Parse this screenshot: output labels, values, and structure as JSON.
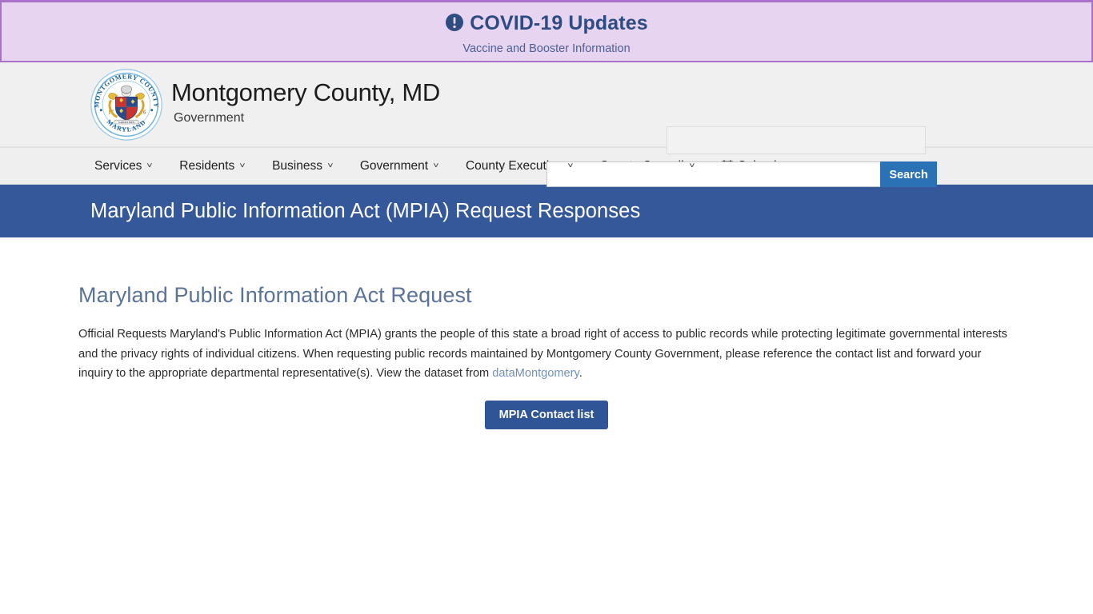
{
  "alert": {
    "icon": "exclamation-circle-icon",
    "title": "COVID-19 Updates",
    "subtitle": "Vaccine and Booster Information",
    "background_color": "#e6d4f1",
    "border_color": "#a972c8",
    "title_color": "#2e4b82"
  },
  "header": {
    "logo": {
      "icon": "montgomery-county-seal-icon",
      "top_arc_text": "MONTGOMERY COUNTY",
      "bottom_arc_text": "MARYLAND",
      "date_left": "17",
      "date_right": "76"
    },
    "brand_name": "Montgomery County, MD",
    "brand_subtitle": "Government",
    "search": {
      "value": "",
      "placeholder": "",
      "button_label": "Search",
      "button_color": "#2a72b5"
    }
  },
  "nav": {
    "items": [
      {
        "label": "Services",
        "has_caret": true,
        "icon": ""
      },
      {
        "label": "Residents",
        "has_caret": true,
        "icon": ""
      },
      {
        "label": "Business",
        "has_caret": true,
        "icon": ""
      },
      {
        "label": "Government",
        "has_caret": true,
        "icon": ""
      },
      {
        "label": "County Executive",
        "has_caret": true,
        "icon": ""
      },
      {
        "label": "County Council",
        "has_caret": true,
        "icon": ""
      },
      {
        "label": "Calendar",
        "has_caret": false,
        "icon": "calendar-icon"
      }
    ]
  },
  "page_band": {
    "title": "Maryland Public Information Act (MPIA) Request Responses",
    "background_color": "#35589a"
  },
  "main": {
    "heading": "Maryland Public Information Act Request",
    "body_part1": "Official Requests Maryland's Public Information Act (MPIA) grants the people of this state a broad right of access to public records while protecting legitimate governmental interests and the privacy rights of individual citizens. When requesting public records maintained by Montgomery County Government, please reference the contact list and forward your inquiry to the appropriate departmental representative(s). View the dataset from ",
    "body_link": "dataMontgomery",
    "body_part2": ".",
    "cta_label": "MPIA Contact list",
    "cta_color": "#2f5596",
    "heading_color": "#5b7396"
  }
}
